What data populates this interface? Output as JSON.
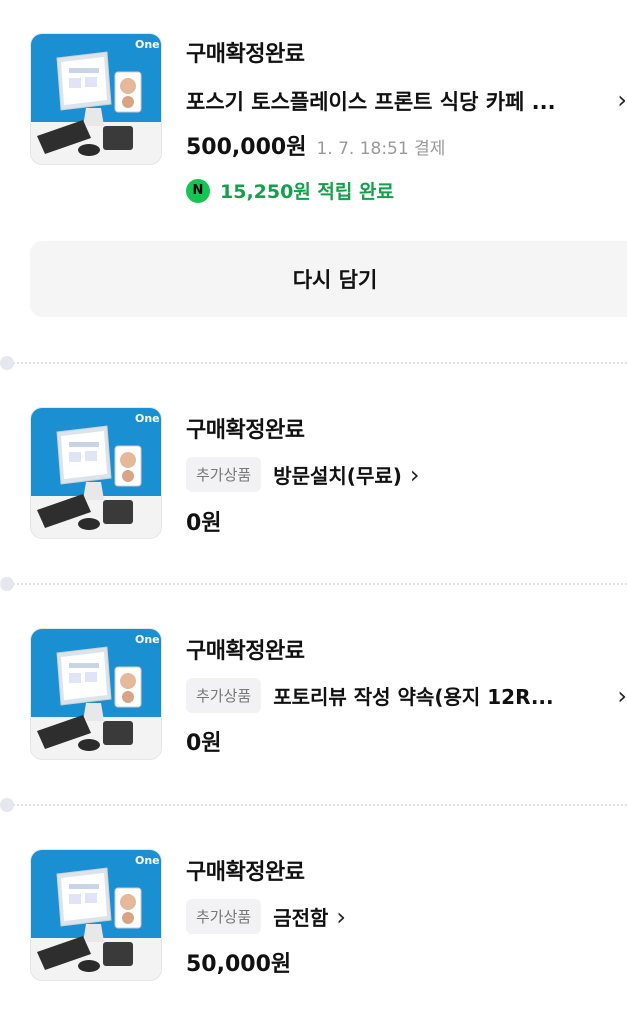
{
  "icons": {
    "product": "pos-terminal-product-image",
    "point": "naver-pay-point-icon",
    "chevron": "chevron-right-icon"
  },
  "colors": {
    "point_green": "#13a04a",
    "badge_green": "#13c552",
    "thumb_bg": "#1a8fd1"
  },
  "thumb_brand": "One",
  "orders": [
    {
      "status": "구매확정완료",
      "title": "포스기 토스플레이스 프론트 식당 카페 ...",
      "price": "500,000원",
      "meta": "1. 7. 18:51 결제",
      "point_badge": "N",
      "point": "15,250원 적립 완료",
      "action": "다시 담기"
    },
    {
      "status": "구매확정완료",
      "tag": "추가상품",
      "name": "방문설치(무료)",
      "price": "0원"
    },
    {
      "status": "구매확정완료",
      "tag": "추가상품",
      "name": "포토리뷰 작성 약속(용지 12R...",
      "price": "0원"
    },
    {
      "status": "구매확정완료",
      "tag": "추가상품",
      "name": "금전함",
      "price": "50,000원"
    }
  ]
}
